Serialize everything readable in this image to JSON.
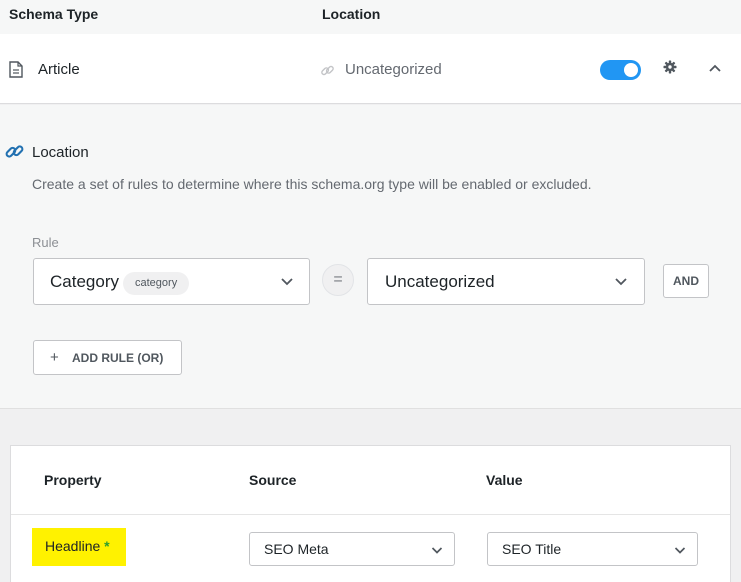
{
  "header": {
    "col_schema_type": "Schema Type",
    "col_location": "Location"
  },
  "schema_row": {
    "type_label": "Article",
    "location_value": "Uncategorized",
    "toggle_state": "on"
  },
  "location_panel": {
    "title": "Location",
    "description": "Create a set of rules to determine where this schema.org type will be enabled or excluded.",
    "rule_label": "Rule",
    "rule": {
      "field_value": "Category",
      "field_tag": "category",
      "operator": "=",
      "match_value": "Uncategorized",
      "and_label": "AND"
    },
    "add_rule_label": "ADD RULE (OR)"
  },
  "properties": {
    "headers": {
      "property": "Property",
      "source": "Source",
      "value": "Value"
    },
    "rows": [
      {
        "property": "Headline",
        "required_mark": "*",
        "source": "SEO Meta",
        "value": "SEO Title"
      }
    ]
  },
  "colors": {
    "toggle_accent": "#2196f3",
    "link_icon": "#2271b1",
    "highlight": "#fff200",
    "required": "#2e9e2e"
  }
}
